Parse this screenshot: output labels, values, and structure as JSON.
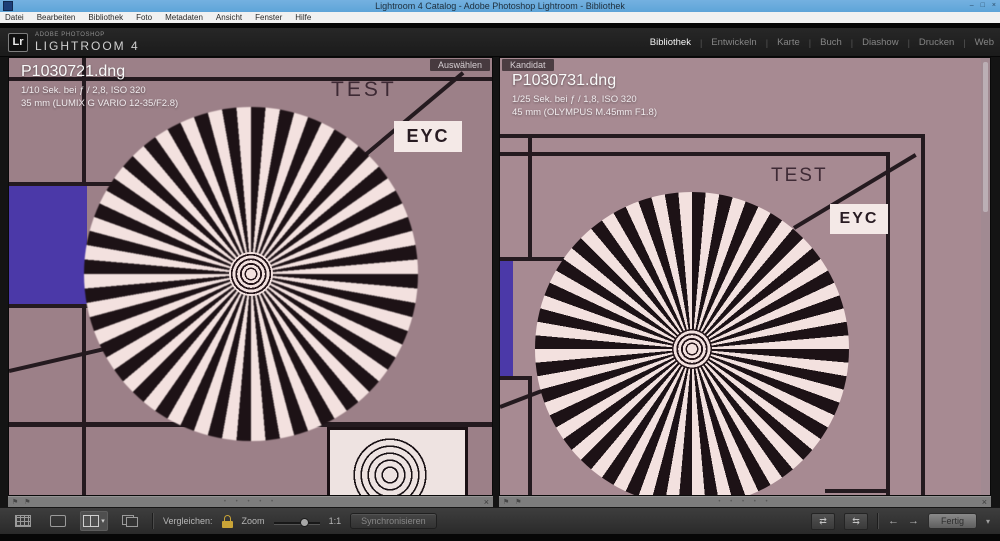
{
  "window": {
    "title": "Lightroom 4 Catalog - Adobe Photoshop Lightroom - Bibliothek",
    "buttons": {
      "minimize": "–",
      "maximize": "□",
      "close": "×"
    }
  },
  "menubar": {
    "items": [
      "Datei",
      "Bearbeiten",
      "Bibliothek",
      "Foto",
      "Metadaten",
      "Ansicht",
      "Fenster",
      "Hilfe"
    ]
  },
  "header": {
    "logo_badge": "Lr",
    "logo_line1": "ADOBE PHOTOSHOP",
    "logo_line2": "LIGHTROOM 4",
    "module_separator": "|",
    "modules": [
      {
        "label": "Bibliothek",
        "active": true
      },
      {
        "label": "Entwickeln"
      },
      {
        "label": "Karte"
      },
      {
        "label": "Buch"
      },
      {
        "label": "Diashow"
      },
      {
        "label": "Drucken"
      },
      {
        "label": "Web"
      }
    ]
  },
  "compare": {
    "select": {
      "tag": "Auswählen",
      "filename": "P1030721.dng",
      "exposure": "1/10 Sek. bei ƒ / 2,8, ISO 320",
      "lens": "35 mm (LUMIX G VARIO 12-35/F2.8)"
    },
    "candidate": {
      "tag": "Kandidat",
      "filename": "P1030731.dng",
      "exposure": "1/25 Sek. bei ƒ / 1,8, ISO 320",
      "lens": "45 mm (OLYMPUS M.45mm F1.8)"
    },
    "chart": {
      "test_label": "TEST",
      "eyc_label": "EYC"
    },
    "strip": {
      "pick_flag": "⚑",
      "reject_flag": "⚑",
      "rating_dots": "• • • • •",
      "close": "×"
    }
  },
  "toolbar": {
    "compare_label": "Vergleichen:",
    "zoom_label": "Zoom",
    "zoom_value": "1:1",
    "sync_button": "Synchronisieren",
    "done_button": "Fertig",
    "prev_arrow": "←",
    "next_arrow": "→",
    "menu_chevron": "▾",
    "swap_icon": "⇄",
    "promote_icon": "⇆"
  },
  "colors": {
    "titlebar": "#64a7da",
    "chart_bg_left": "#9c8088",
    "chart_bg_right": "#a78a92",
    "blue_patch": "#4b39a8",
    "star_dark": "#1d1216",
    "star_light": "#f3e1df",
    "lock_gold": "#c9a437",
    "strip_gray": "#7d7d7d"
  }
}
